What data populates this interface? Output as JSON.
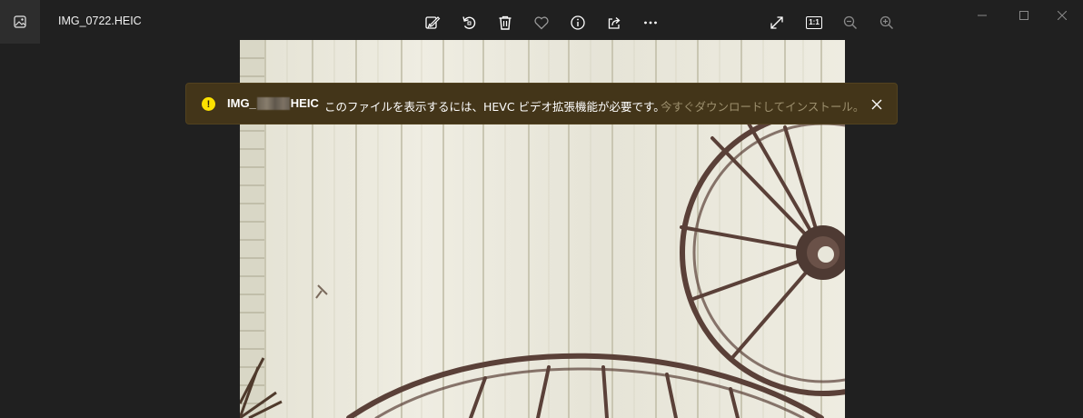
{
  "window": {
    "title": "IMG_0722.HEIC"
  },
  "toolbar": {
    "buttons": [
      {
        "name": "edit-icon"
      },
      {
        "name": "rotate-icon"
      },
      {
        "name": "delete-icon"
      },
      {
        "name": "favorite-heart-icon"
      },
      {
        "name": "info-icon"
      },
      {
        "name": "share-icon"
      },
      {
        "name": "more-icon"
      }
    ],
    "right_buttons": [
      {
        "name": "fullscreen-icon"
      },
      {
        "name": "actual-size-icon",
        "label": "1:1"
      },
      {
        "name": "zoom-out-icon"
      },
      {
        "name": "zoom-in-icon"
      }
    ]
  },
  "banner": {
    "file_prefix": "IMG_",
    "file_suffix": "HEIC",
    "message": "このファイルを表示するには、HEVC ビデオ拡張機能が必要です。",
    "link": "今すぐダウンロードしてインストール。",
    "warning_symbol": "!"
  },
  "colors": {
    "background": "#202020",
    "banner_bg": "#433519",
    "warning": "#fce100",
    "link": "#9c8f6d"
  }
}
